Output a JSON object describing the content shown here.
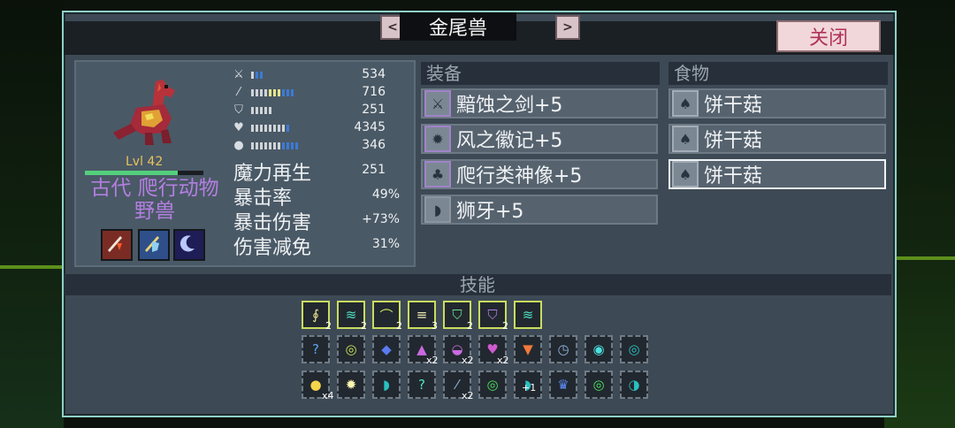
{
  "header": {
    "title": "金尾兽",
    "prev_label": "<",
    "next_label": ">",
    "close_label": "关闭"
  },
  "character": {
    "level": "Lvl 42",
    "xp_fraction": 0.78,
    "species": "古代 爬行动物 野兽",
    "stats": [
      {
        "icon": "sword-icon",
        "value": "534"
      },
      {
        "icon": "wand-icon",
        "value": "716"
      },
      {
        "icon": "shield-icon",
        "value": "251"
      },
      {
        "icon": "heart-icon",
        "value": "4345"
      },
      {
        "icon": "boot-icon",
        "value": "346"
      }
    ],
    "extra_stats": [
      {
        "label": "魔力再生",
        "value": "251"
      },
      {
        "label": "暴击率",
        "value": "49%"
      },
      {
        "label": "暴击伤害",
        "value": "+73%"
      },
      {
        "label": "伤害减免",
        "value": "31%"
      }
    ]
  },
  "equipment": {
    "title": "装备",
    "items": [
      "黯蚀之剑+5",
      "风之徽记+5",
      "爬行类神像+5",
      "狮牙+5"
    ]
  },
  "food": {
    "title": "食物",
    "items": [
      "饼干菇",
      "饼干菇",
      "饼干菇"
    ]
  },
  "skills": {
    "title": "技能",
    "counts": [
      "2",
      "2",
      "2",
      "3",
      "2",
      "2",
      "x2",
      "x2",
      "x2",
      "x4",
      "x2",
      "+1"
    ]
  },
  "colors": {
    "accent": "#8fd0c8",
    "species": "#b37fe0",
    "level": "#e9c25c",
    "close_text": "#b0325a"
  }
}
